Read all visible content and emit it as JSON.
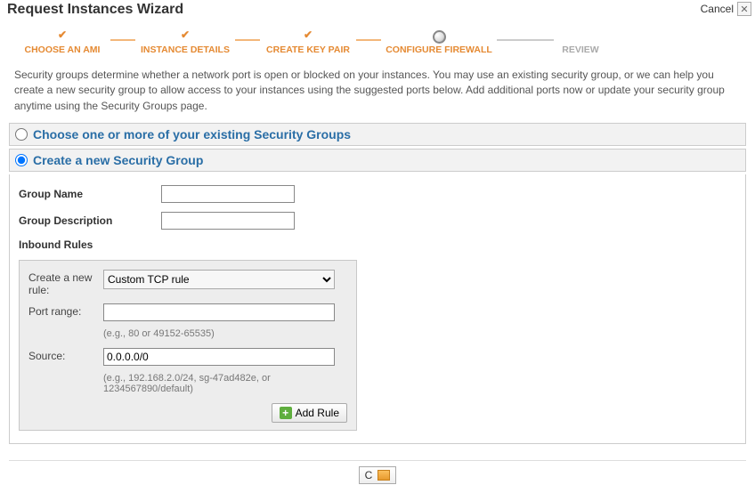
{
  "header": {
    "title": "Request Instances Wizard",
    "cancel": "Cancel"
  },
  "steps": {
    "s1": "CHOOSE AN AMI",
    "s2": "INSTANCE DETAILS",
    "s3": "CREATE KEY PAIR",
    "s4": "CONFIGURE FIREWALL",
    "s5": "REVIEW"
  },
  "intro": "Security groups determine whether a network port is open or blocked on your instances. You may use an existing security group, or we can help you create a new security group to allow access to your instances using the suggested ports below. Add additional ports now or update your security group anytime using the Security Groups page.",
  "options": {
    "existing_label": "Choose one or more of your existing Security Groups",
    "create_label": "Create a new Security Group"
  },
  "form": {
    "group_name_label": "Group Name",
    "group_name_value": "",
    "group_desc_label": "Group Description",
    "group_desc_value": "",
    "inbound_title": "Inbound Rules"
  },
  "rule": {
    "new_rule_label": "Create a new rule:",
    "rule_type_selected": "Custom TCP rule",
    "port_label": "Port range:",
    "port_value": "",
    "port_hint": "(e.g., 80 or 49152-65535)",
    "source_label": "Source:",
    "source_value": "0.0.0.0/0",
    "source_hint": "(e.g., 192.168.2.0/24, sg-47ad482e, or 1234567890/default)",
    "add_rule_label": "Add Rule"
  },
  "footer": {
    "continue_partial": "C"
  }
}
